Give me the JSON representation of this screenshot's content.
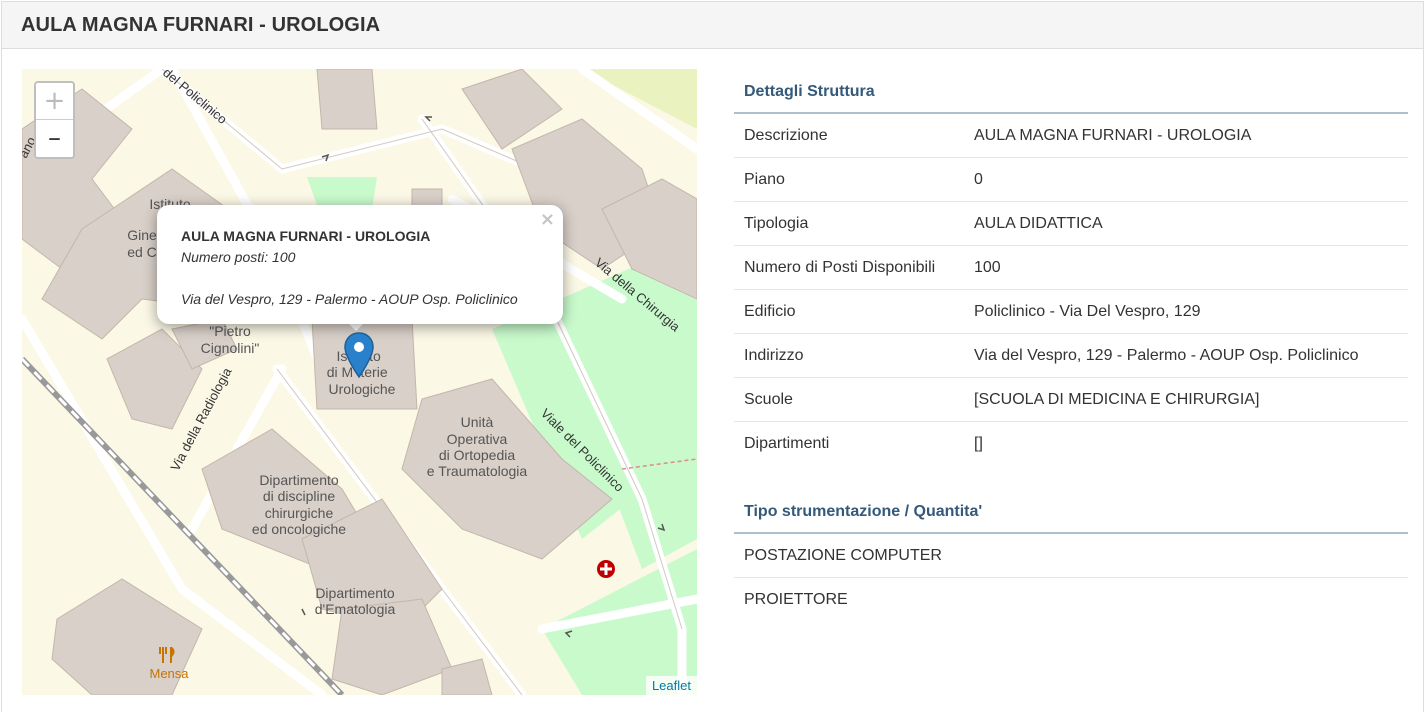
{
  "page": {
    "title": "AULA MAGNA FURNARI - UROLOGIA"
  },
  "map": {
    "zoom_in": "+",
    "zoom_out": "–",
    "attribution": "Leaflet",
    "popup": {
      "close": "×",
      "title": "AULA MAGNA FURNARI - UROLOGIA",
      "seats": "Numero posti: 100",
      "address": "Via del Vespro, 129 - Palermo - AOUP Osp. Policlinico"
    },
    "labels": {
      "istituto": "Istituto",
      "gine": "Gine",
      "edc": "ed C",
      "pietro": "\"Pietro",
      "cignolini": "Cignolini\"",
      "is": "Is",
      "to": "to",
      "di": "di M",
      "terie": "terie",
      "urologiche": "Urologiche",
      "unita": "Unità",
      "operativa": "Operativa",
      "ortopedia": "di Ortopedia",
      "trauma": "e Traumatologia",
      "dip1": "Dipartimento",
      "dip2": "di discipline",
      "dip3": "chirurgiche",
      "dip4": "ed oncologiche",
      "ema1": "Dipartimento",
      "ema2": "d'Ematologia",
      "mensa": "Mensa",
      "road_policlinico_top": "del Policlinico",
      "road_chirurgia": "Via della Chirurgia",
      "road_radiologia": "Via della Radiologia",
      "road_viale": "Viale del Policlinico",
      "road_corner": "ano"
    }
  },
  "details": {
    "title": "Dettagli Struttura",
    "rows": [
      {
        "k": "Descrizione",
        "v": "AULA MAGNA FURNARI - UROLOGIA"
      },
      {
        "k": "Piano",
        "v": "0"
      },
      {
        "k": "Tipologia",
        "v": "AULA DIDATTICA"
      },
      {
        "k": "Numero di Posti Disponibili",
        "v": "100"
      },
      {
        "k": "Edificio",
        "v": "Policlinico - Via Del Vespro, 129"
      },
      {
        "k": "Indirizzo",
        "v": "Via del Vespro, 129 - Palermo - AOUP Osp. Policlinico"
      },
      {
        "k": "Scuole",
        "v": "[SCUOLA DI MEDICINA E CHIRURGIA]"
      },
      {
        "k": "Dipartimenti",
        "v": "[]"
      }
    ]
  },
  "equipment": {
    "title": "Tipo strumentazione / Quantita'",
    "items": [
      {
        "name": "POSTAZIONE COMPUTER"
      },
      {
        "name": "PROIETTORE"
      }
    ]
  },
  "colors": {
    "building": "#d9d0c9",
    "green": "#c8facc",
    "road": "#ffffff",
    "background": "#fbf8e6",
    "marker": "#2a81cb",
    "hospital": "#bf0000"
  }
}
